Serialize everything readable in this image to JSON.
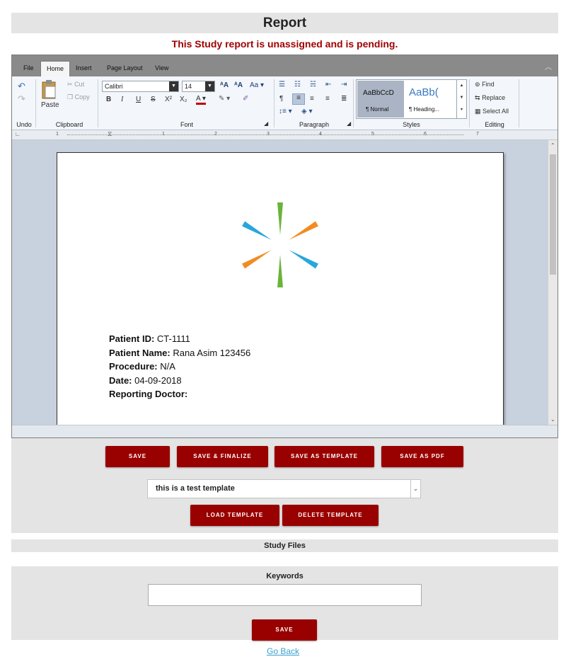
{
  "page": {
    "title": "Report",
    "status_message": "This Study report is unassigned and is pending."
  },
  "editor": {
    "tabs": [
      "File",
      "Home",
      "Insert",
      "Page Layout",
      "View"
    ],
    "active_tab": "Home",
    "groups": {
      "undo": "Undo",
      "clipboard": "Clipboard",
      "font": "Font",
      "paragraph": "Paragraph",
      "styles": "Styles",
      "editing": "Editing"
    },
    "clipboard": {
      "paste": "Paste",
      "cut": "Cut",
      "copy": "Copy"
    },
    "font": {
      "family": "Calibri",
      "size": "14"
    },
    "styles": {
      "normal_preview": "AaBbCcD",
      "normal_label": "¶ Normal",
      "heading_preview": "AaBb(",
      "heading_label": "¶ Heading..."
    },
    "editing": {
      "find": "Find",
      "replace": "Replace",
      "select_all": "Select All"
    },
    "ruler_marks": [
      "1",
      "1",
      "2",
      "3",
      "4",
      "5",
      "6",
      "7"
    ],
    "document": {
      "patient_id_label": "Patient ID:",
      "patient_id": "CT-1111",
      "patient_name_label": "Patient Name:",
      "patient_name": "Rana Asim 123456",
      "procedure_label": "Procedure:",
      "procedure": "N/A",
      "date_label": "Date:",
      "date": "04-09-2018",
      "doctor_label": "Reporting Doctor:"
    }
  },
  "actions": {
    "save": "SAVE",
    "save_finalize": "SAVE & FINALIZE",
    "save_template": "SAVE AS TEMPLATE",
    "save_pdf": "SAVE AS PDF",
    "load_template": "LOAD TEMPLATE",
    "delete_template": "DELETE TEMPLATE"
  },
  "template_select": {
    "value": "this is a test template"
  },
  "study_files": {
    "title": "Study Files"
  },
  "keywords": {
    "title": "Keywords",
    "value": "",
    "save": "SAVE"
  },
  "footer": {
    "go_back": "Go Back"
  },
  "colors": {
    "button": "#990000",
    "status": "#a00000",
    "logo_blue": "#2aa6dc",
    "logo_orange": "#f28b22",
    "logo_green": "#6ab43a"
  }
}
